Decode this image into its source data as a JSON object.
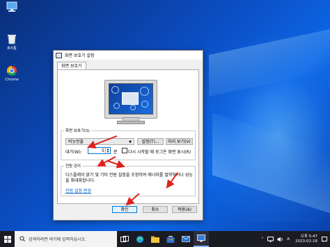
{
  "desktop": {
    "icons": [
      {
        "label": "휴지통",
        "icon": "recycle-bin-icon"
      },
      {
        "label": "Chrome",
        "icon": "chrome-icon"
      }
    ]
  },
  "dialog": {
    "title": "화면 보호기 설정",
    "tab": "화면 보호기",
    "screensaver": {
      "group_label": "화면 보호기(S)",
      "selected": "비눗방울",
      "settings_button": "설정(T)...",
      "preview_button": "미리 보기(V)",
      "wait_label": "대기(W):",
      "wait_value": "5",
      "wait_unit": "분",
      "resume_checkbox_label": "다시 시작할 때 로그온 화면 표시(R)",
      "resume_checked": false
    },
    "power": {
      "group_label": "전원 관리",
      "description": "디스플레이 밝기 및 기타 전원 설정을 조정하여 에너지를 절약하거나 성능을 최대화합니다.",
      "link": "전원 설정 변경"
    },
    "buttons": {
      "ok": "확인",
      "cancel": "취소",
      "apply": "적용(A)"
    }
  },
  "taskbar": {
    "search_placeholder": "검색하려면 여기에 입력하십시오.",
    "ime": "A",
    "time": "오후 5:47",
    "date": "2023-02-16"
  },
  "colors": {
    "annotation_arrow": "#e0201b",
    "accent": "#0078d7"
  }
}
